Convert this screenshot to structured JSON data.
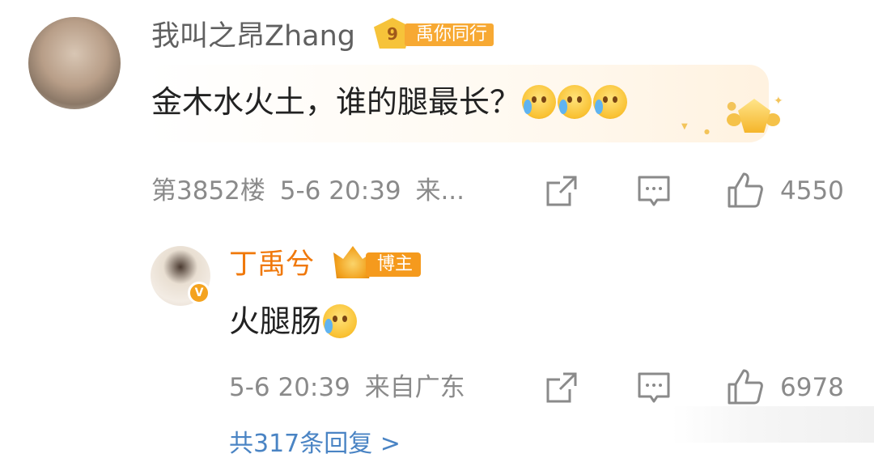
{
  "comment": {
    "username": "我叫之昂Zhang",
    "fan_badge": {
      "level": "9",
      "label": "禹你同行"
    },
    "text": "金木水火土，谁的腿最长？",
    "emojis": [
      "crying-laugh-emoji",
      "crying-laugh-emoji",
      "crying-laugh-emoji"
    ],
    "floor": "第3852楼",
    "time": "5-6 20:39",
    "source_truncated": "来...",
    "like_count": "4550"
  },
  "reply": {
    "username": "丁禹兮",
    "badge_label": "博主",
    "verified_mark": "V",
    "text": "火腿肠",
    "time": "5-6 20:39",
    "source": "来自广东",
    "like_count": "6978"
  },
  "more_replies_text": "共317条回复 >",
  "colors": {
    "blogger_name": "#f0780a",
    "badge_orange": "#f59a1d",
    "link_blue": "#4a84c4",
    "meta_gray": "#8a8a8a"
  }
}
